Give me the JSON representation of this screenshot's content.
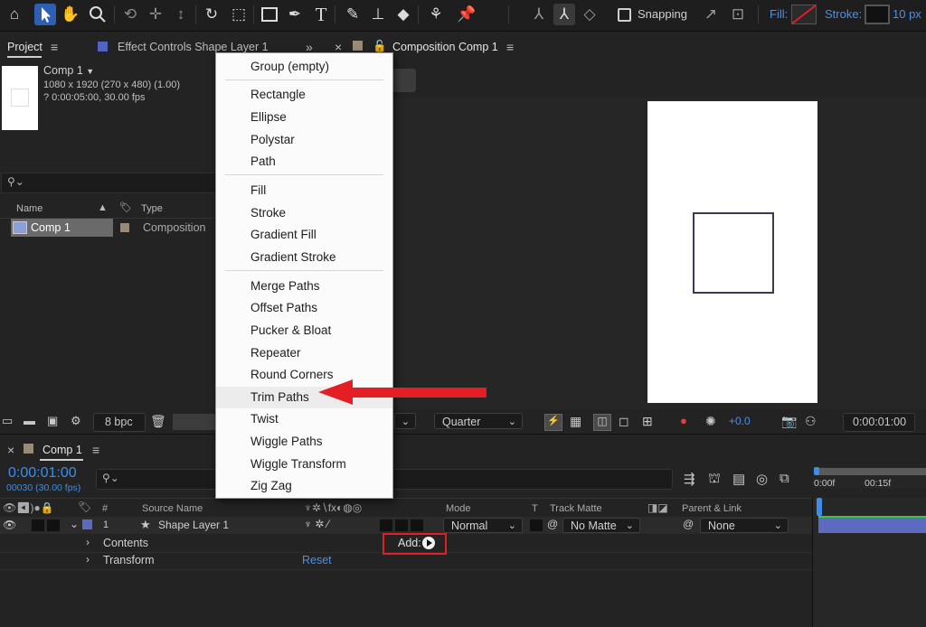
{
  "toolbar": {
    "snapping_label": "Snapping",
    "fill_label": "Fill:",
    "stroke_label": "Stroke:",
    "stroke_width": "10 px",
    "icons": [
      "home-icon",
      "selection-icon",
      "hand-icon",
      "zoom-icon",
      "orbit-icon",
      "pan-icon",
      "dolly-icon",
      "rotate-icon",
      "anchor-icon",
      "rectangle-icon",
      "pen-icon",
      "type-icon",
      "brush-icon",
      "clone-stamp-icon",
      "eraser-icon",
      "roto-brush-icon",
      "puppet-pin-icon"
    ]
  },
  "project_panel": {
    "tab_label": "Project",
    "effect_controls_label": "Effect Controls Shape Layer 1",
    "comp_name": "Comp 1",
    "comp_dims": "1080 x 1920  (270 x 480) (1.00)",
    "comp_duration": "? 0:00:05:00, 30.00 fps",
    "search_placeholder": "",
    "col_name": "Name",
    "col_type": "Type",
    "row_name": "Comp 1",
    "row_type": "Composition",
    "bpc": "8 bpc"
  },
  "composition_panel": {
    "tab_label": "Composition Comp 1",
    "resolution": "Quarter",
    "exposure": "+0.0",
    "timecode": "0:00:01:00"
  },
  "context_menu": {
    "items": [
      {
        "label": "Group (empty)"
      },
      {
        "label": "Rectangle"
      },
      {
        "label": "Ellipse"
      },
      {
        "label": "Polystar"
      },
      {
        "label": "Path"
      },
      {
        "label": "Fill"
      },
      {
        "label": "Stroke"
      },
      {
        "label": "Gradient Fill"
      },
      {
        "label": "Gradient Stroke"
      },
      {
        "label": "Merge Paths"
      },
      {
        "label": "Offset Paths"
      },
      {
        "label": "Pucker & Bloat"
      },
      {
        "label": "Repeater"
      },
      {
        "label": "Round Corners"
      },
      {
        "label": "Trim Paths"
      },
      {
        "label": "Twist"
      },
      {
        "label": "Wiggle Paths"
      },
      {
        "label": "Wiggle Transform"
      },
      {
        "label": "Zig Zag"
      }
    ],
    "highlighted": "Trim Paths"
  },
  "timeline": {
    "tab_label": "Comp 1",
    "current_time": "0:00:01:00",
    "frame_info": "00030 (30.00 fps)",
    "col_hash": "#",
    "col_source_name": "Source Name",
    "col_mode": "Mode",
    "col_t": "T",
    "col_track_matte": "Track Matte",
    "col_parent": "Parent & Link",
    "layer_index": "1",
    "layer_name": "Shape Layer 1",
    "layer_mode": "Normal",
    "layer_matte": "No Matte",
    "layer_parent": "None",
    "contents_label": "Contents",
    "transform_label": "Transform",
    "reset_label": "Reset",
    "add_label": "Add:",
    "ruler_0": "0:00f",
    "ruler_15": "00:15f"
  },
  "colors": {
    "accent_blue": "#2d5fb4",
    "timecode_blue": "#3d8ee8",
    "annotation_red": "#e31e24",
    "layer_label": "#5c6ac0"
  }
}
